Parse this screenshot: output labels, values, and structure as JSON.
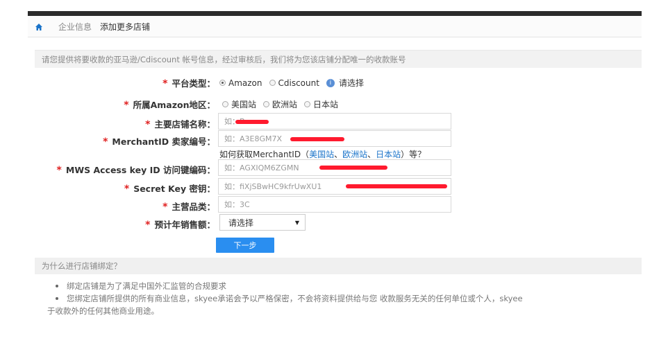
{
  "breadcrumb": {
    "home_icon": "home-icon",
    "link": "企业信息",
    "current": "添加更多店铺"
  },
  "notice": "请您提供将要收款的亚马逊/Cdiscount 帐号信息，经过审核后，我们将为您该店铺分配唯一的收款账号",
  "form": {
    "platform": {
      "label": "平台类型：",
      "options": [
        "Amazon",
        "Cdiscount"
      ],
      "selected": "Amazon",
      "hint": "请选择"
    },
    "region": {
      "label": "所属Amazon地区：",
      "options": [
        "美国站",
        "欧洲站",
        "日本站"
      ]
    },
    "store_name": {
      "label": "主要店铺名称：",
      "placeholder": "如：B"
    },
    "merchant_id": {
      "label": "MerchantID 卖家编号：",
      "placeholder": "如：A3E8GM7X"
    },
    "help": {
      "prefix": "如何获取MerchantID（",
      "links": [
        "美国站",
        "欧洲站",
        "日本站"
      ],
      "suffix": "）等？"
    },
    "access_key": {
      "label": "MWS Access key ID 访问键编码：",
      "placeholder": "如：AGXIQM6ZGMN"
    },
    "secret_key": {
      "label": "Secret Key 密钥：",
      "placeholder": "如：fiXjSBwHC9kfrUwXU1"
    },
    "category": {
      "label": "主营品类：",
      "placeholder": "如：3C"
    },
    "annual_sales": {
      "label": "预计年销售额：",
      "selected": "请选择"
    },
    "next_label": "下一步"
  },
  "why": {
    "title": "为什么进行店铺绑定？",
    "items": [
      "绑定店铺是为了满足中国外汇监管的合规要求",
      "您绑定店铺所提供的所有商业信息，skyee承诺会予以严格保密，不会将资料提供给与您 收款服务无关的任何单位或个人，skyee"
    ],
    "continuation": "于收款外的任何其他商业用途。"
  },
  "colors": {
    "accent": "#2a8ef0",
    "required": "#e02020",
    "redaction": "#ff1a2e",
    "link": "#1a73c9"
  }
}
